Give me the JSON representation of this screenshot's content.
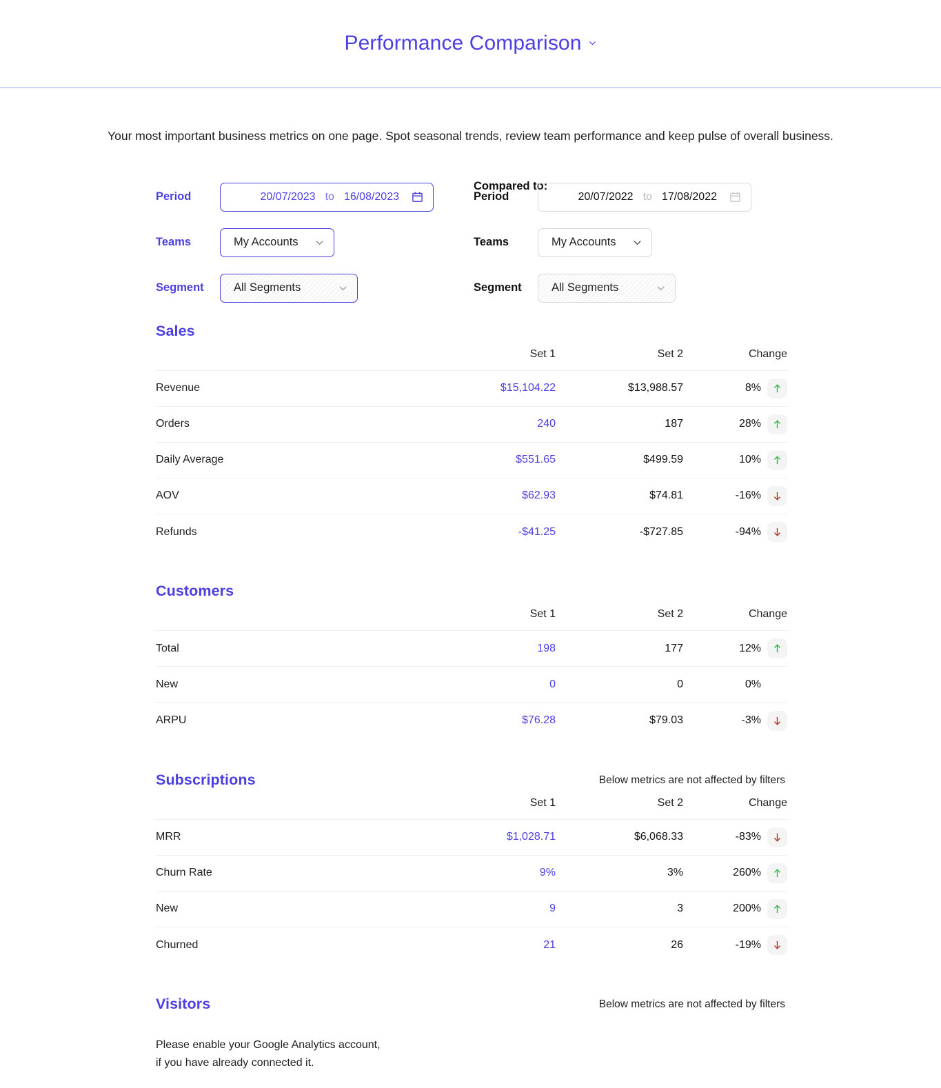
{
  "header": {
    "title": "Performance Comparison",
    "chevron_icon": "chevron-down-icon"
  },
  "subtitle": "Your most important business metrics on one page. Spot seasonal trends, review team performance and keep pulse of overall business.",
  "filters": {
    "compared_to_label": "Compared to:",
    "primary": {
      "period_label": "Period",
      "period_start": "20/07/2023",
      "period_to": "to",
      "period_end": "16/08/2023",
      "calendar_icon": "calendar-icon",
      "teams_label": "Teams",
      "teams_value": "My Accounts",
      "segment_label": "Segment",
      "segment_value": "All Segments"
    },
    "comparison": {
      "period_label": "Period",
      "period_start": "20/07/2022",
      "period_to": "to",
      "period_end": "17/08/2022",
      "calendar_icon": "calendar-icon",
      "teams_label": "Teams",
      "teams_value": "My Accounts",
      "segment_label": "Segment",
      "segment_value": "All Segments"
    }
  },
  "columns": {
    "set1": "Set 1",
    "set2": "Set 2",
    "change": "Change"
  },
  "colors": {
    "accent": "#4b3fe4",
    "up": "#3cb54a",
    "down": "#b33a2b",
    "divider": "#ccd6f7"
  },
  "sections": [
    {
      "title": "Sales",
      "note": "",
      "rows": [
        {
          "name": "Revenue",
          "set1": "$15,104.22",
          "set2": "$13,988.57",
          "change": "8%",
          "direction": "up"
        },
        {
          "name": "Orders",
          "set1": "240",
          "set2": "187",
          "change": "28%",
          "direction": "up"
        },
        {
          "name": "Daily Average",
          "set1": "$551.65",
          "set2": "$499.59",
          "change": "10%",
          "direction": "up"
        },
        {
          "name": "AOV",
          "set1": "$62.93",
          "set2": "$74.81",
          "change": "-16%",
          "direction": "down"
        },
        {
          "name": "Refunds",
          "set1": "-$41.25",
          "set2": "-$727.85",
          "change": "-94%",
          "direction": "down"
        }
      ]
    },
    {
      "title": "Customers",
      "note": "",
      "rows": [
        {
          "name": "Total",
          "set1": "198",
          "set2": "177",
          "change": "12%",
          "direction": "up"
        },
        {
          "name": "New",
          "set1": "0",
          "set2": "0",
          "change": "0%",
          "direction": "none"
        },
        {
          "name": "ARPU",
          "set1": "$76.28",
          "set2": "$79.03",
          "change": "-3%",
          "direction": "down"
        }
      ]
    },
    {
      "title": "Subscriptions",
      "note": "Below metrics are not affected by filters",
      "rows": [
        {
          "name": "MRR",
          "set1": "$1,028.71",
          "set2": "$6,068.33",
          "change": "-83%",
          "direction": "down"
        },
        {
          "name": "Churn Rate",
          "set1": "9%",
          "set2": "3%",
          "change": "260%",
          "direction": "up"
        },
        {
          "name": "New",
          "set1": "9",
          "set2": "3",
          "change": "200%",
          "direction": "up"
        },
        {
          "name": "Churned",
          "set1": "21",
          "set2": "26",
          "change": "-19%",
          "direction": "down"
        }
      ]
    }
  ],
  "visitors": {
    "title": "Visitors",
    "note": "Below metrics are not affected by filters",
    "message_line1": "Please enable your Google Analytics account,",
    "message_line2": "if you have already connected it."
  }
}
